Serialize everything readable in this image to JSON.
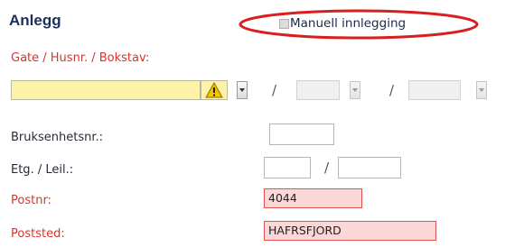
{
  "section": {
    "title": "Anlegg",
    "manual_entry_label": "Manuell innlegging",
    "manual_entry_checked": false
  },
  "fields": {
    "street_label": "Gate / Husnr. / Bokstav:",
    "street_value": "",
    "house_no_value": "",
    "letter_value": "",
    "separator": "/",
    "unit_no_label": "Bruksenhetsnr.:",
    "unit_no_value": "",
    "floor_label": "Etg. / Leil.:",
    "floor_value": "",
    "apartment_value": "",
    "postal_code_label": "Postnr:",
    "postal_code_value": "4044",
    "postal_place_label": "Poststed:",
    "postal_place_value": "HAFRSFJORD"
  },
  "colors": {
    "title": "#17325c",
    "required_label": "#d8342c",
    "warning_bg": "#fcf3a6",
    "error_bg": "#fcd7d7",
    "error_border": "#e05050",
    "highlight_oval": "#d81e1e"
  }
}
